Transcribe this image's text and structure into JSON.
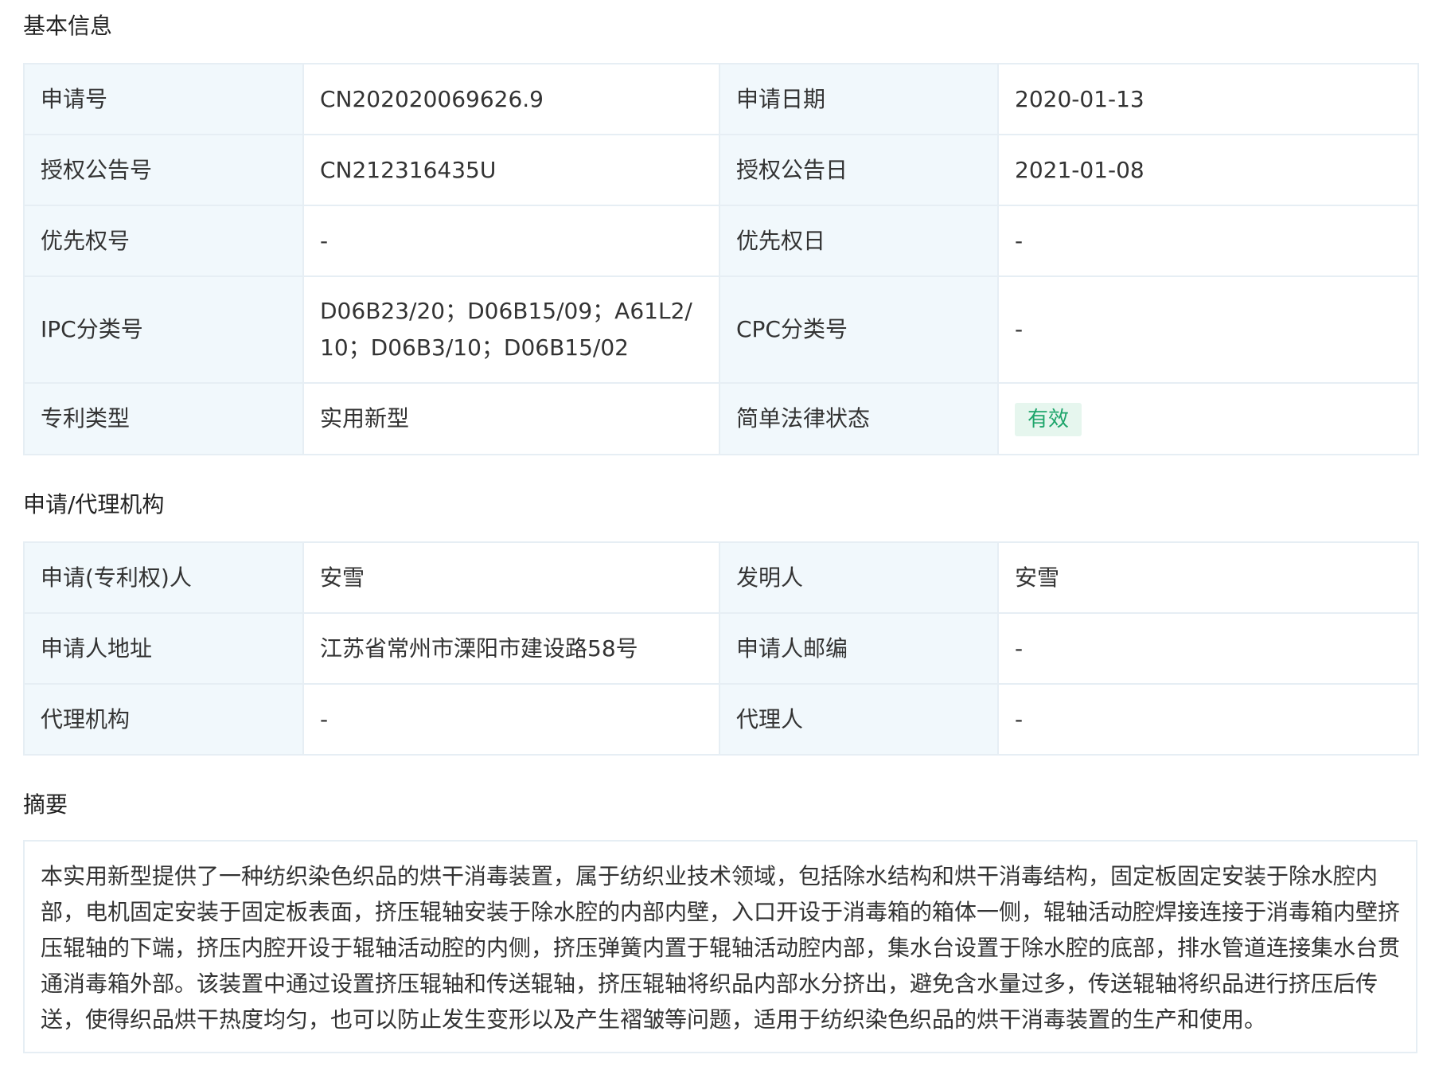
{
  "sections": {
    "basic_info": "基本信息",
    "applicant_agency": "申请/代理机构",
    "abstract": "摘要"
  },
  "basic_info": [
    {
      "label1": "申请号",
      "value1": "CN202020069626.9",
      "label2": "申请日期",
      "value2": "2020-01-13"
    },
    {
      "label1": "授权公告号",
      "value1": "CN212316435U",
      "label2": "授权公告日",
      "value2": "2021-01-08"
    },
    {
      "label1": "优先权号",
      "value1": "-",
      "label2": "优先权日",
      "value2": "-"
    },
    {
      "label1": "IPC分类号",
      "value1": "D06B23/20；D06B15/09；A61L2/10；D06B3/10；D06B15/02",
      "label2": "CPC分类号",
      "value2": "-"
    },
    {
      "label1": "专利类型",
      "value1": "实用新型",
      "label2": "简单法律状态",
      "value2": "有效"
    }
  ],
  "status_color": "#1ea56b",
  "applicant_agency": [
    {
      "label1": "申请(专利权)人",
      "value1": "安雪",
      "label2": "发明人",
      "value2": "安雪"
    },
    {
      "label1": "申请人地址",
      "value1": "江苏省常州市溧阳市建设路58号",
      "label2": "申请人邮编",
      "value2": "-"
    },
    {
      "label1": "代理机构",
      "value1": "-",
      "label2": "代理人",
      "value2": "-"
    }
  ],
  "abstract_text": "本实用新型提供了一种纺织染色织品的烘干消毒装置，属于纺织业技术领域，包括除水结构和烘干消毒结构，固定板固定安装于除水腔内部，电机固定安装于固定板表面，挤压辊轴安装于除水腔的内部内壁，入口开设于消毒箱的箱体一侧，辊轴活动腔焊接连接于消毒箱内壁挤压辊轴的下端，挤压内腔开设于辊轴活动腔的内侧，挤压弹簧内置于辊轴活动腔内部，集水台设置于除水腔的底部，排水管道连接集水台贯通消毒箱外部。该装置中通过设置挤压辊轴和传送辊轴，挤压辊轴将织品内部水分挤出，避免含水量过多，传送辊轴将织品进行挤压后传送，使得织品烘干热度均匀，也可以防止发生变形以及产生褶皱等问题，适用于纺织染色织品的烘干消毒装置的生产和使用。"
}
